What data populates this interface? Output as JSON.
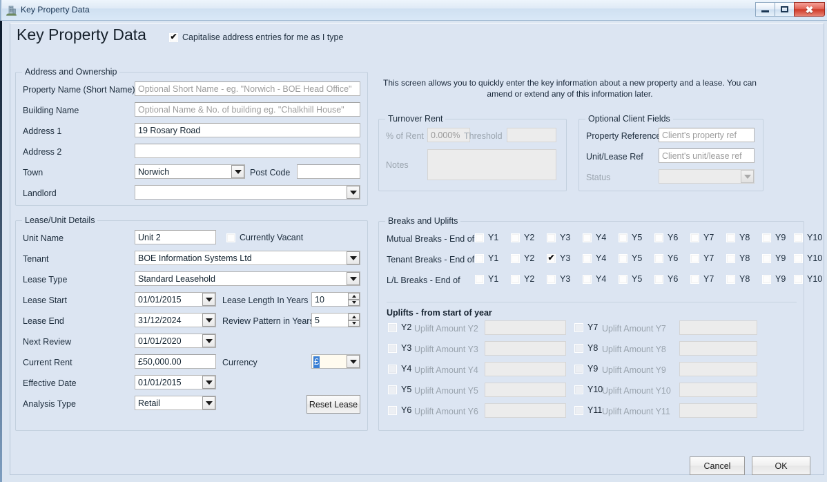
{
  "window": {
    "title": "Key Property Data",
    "icon": "building-icon",
    "minimize_label": "Minimize",
    "maximize_label": "Maximize",
    "close_label": "Close"
  },
  "header": {
    "page_title": "Key Property Data",
    "capitalise_checkbox": {
      "label": "Capitalise address entries for me as I type",
      "checked": true
    }
  },
  "hint": "This screen allows you to quickly enter the key information about a new property and a lease. You can amend or extend any of this information later.",
  "address_group": {
    "title": "Address and Ownership",
    "fields": [
      {
        "label": "Property Name (Short Name)",
        "value": "",
        "placeholder": "Optional Short Name - eg. \"Norwich - BOE Head Office\""
      },
      {
        "label": "Building Name",
        "value": "",
        "placeholder": "Optional Name & No. of building eg. \"Chalkhill House\""
      },
      {
        "label": "Address 1",
        "value": "19 Rosary Road",
        "placeholder": ""
      },
      {
        "label": "Address 2",
        "value": "",
        "placeholder": ""
      }
    ],
    "town": {
      "label": "Town",
      "value": "Norwich"
    },
    "post_code": {
      "label": "Post Code",
      "value": ""
    },
    "landlord": {
      "label": "Landlord",
      "value": ""
    }
  },
  "lease_group": {
    "title": "Lease/Unit Details",
    "unit_name": {
      "label": "Unit Name",
      "value": "Unit 2"
    },
    "currently_vacant": {
      "label": "Currently Vacant",
      "checked": false
    },
    "tenant": {
      "label": "Tenant",
      "value": "BOE Information Systems Ltd"
    },
    "lease_type": {
      "label": "Lease Type",
      "value": "Standard Leasehold"
    },
    "lease_start": {
      "label": "Lease Start",
      "value": "01/01/2015"
    },
    "lease_length": {
      "label": "Lease Length In Years",
      "value": "10"
    },
    "lease_end": {
      "label": "Lease End",
      "value": "31/12/2024"
    },
    "review_pattern": {
      "label": "Review Pattern in Years",
      "value": "5"
    },
    "next_review": {
      "label": "Next Review",
      "value": "01/01/2020"
    },
    "current_rent": {
      "label": "Current Rent",
      "value": "£50,000.00"
    },
    "currency": {
      "label": "Currency",
      "value": "£"
    },
    "effective_date": {
      "label": "Effective Date",
      "value": "01/01/2015"
    },
    "analysis_type": {
      "label": "Analysis Type",
      "value": "Retail"
    },
    "reset_button": "Reset Lease"
  },
  "turnover_group": {
    "title": "Turnover Rent",
    "percent_of_rent": {
      "label": "% of Rent",
      "value": "0.000%"
    },
    "threshold": {
      "label": "Threshold",
      "value": ""
    },
    "notes": {
      "label": "Notes",
      "value": ""
    }
  },
  "client_fields_group": {
    "title": "Optional Client Fields",
    "property_reference": {
      "label": "Property Reference",
      "value": "",
      "placeholder": "Client's property ref"
    },
    "unit_lease_ref": {
      "label": "Unit/Lease Ref",
      "value": "",
      "placeholder": "Client's unit/lease ref"
    },
    "status": {
      "label": "Status",
      "value": ""
    }
  },
  "breaks_group": {
    "title": "Breaks and Uplifts",
    "year_labels": [
      "Y1",
      "Y2",
      "Y3",
      "Y4",
      "Y5",
      "Y6",
      "Y7",
      "Y8",
      "Y9",
      "Y10"
    ],
    "rows": [
      {
        "label": "Mutual Breaks - End of",
        "checked": []
      },
      {
        "label": "Tenant Breaks - End of",
        "checked": [
          "Y3"
        ]
      },
      {
        "label": "L/L Breaks - End of",
        "checked": []
      }
    ],
    "uplifts_title": "Uplifts - from start of year",
    "uplifts_col1": [
      {
        "year": "Y2",
        "amount_label": "Uplift Amount Y2",
        "value": "",
        "checked": false
      },
      {
        "year": "Y3",
        "amount_label": "Uplift Amount Y3",
        "value": "",
        "checked": false
      },
      {
        "year": "Y4",
        "amount_label": "Uplift Amount Y4",
        "value": "",
        "checked": false
      },
      {
        "year": "Y5",
        "amount_label": "Uplift Amount Y5",
        "value": "",
        "checked": false
      },
      {
        "year": "Y6",
        "amount_label": "Uplift Amount Y6",
        "value": "",
        "checked": false
      }
    ],
    "uplifts_col2": [
      {
        "year": "Y7",
        "amount_label": "Uplift Amount Y7",
        "value": "",
        "checked": false
      },
      {
        "year": "Y8",
        "amount_label": "Uplift Amount Y8",
        "value": "",
        "checked": false
      },
      {
        "year": "Y9",
        "amount_label": "Uplift Amount Y9",
        "value": "",
        "checked": false
      },
      {
        "year": "Y10",
        "amount_label": "Uplift Amount Y10",
        "value": "",
        "checked": false
      },
      {
        "year": "Y11",
        "amount_label": "Uplift Amount Y11",
        "value": "",
        "checked": false
      }
    ]
  },
  "footer": {
    "cancel_label": "Cancel",
    "ok_label": "OK"
  },
  "colors": {
    "form_background": "#dce5f2",
    "titlebar": "#dfeaf6",
    "close_button": "#cf3a28",
    "selection_blue": "#3a7fd5",
    "focused_field": "#fffbef"
  }
}
